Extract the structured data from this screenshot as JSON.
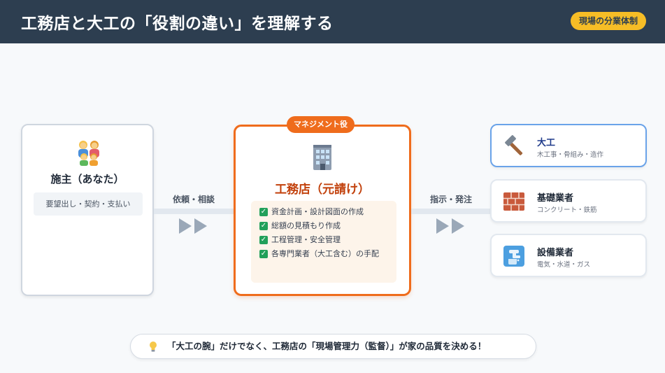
{
  "header": {
    "title": "工務店と大工の「役割の違い」を理解する",
    "badge": "現場の分業体制"
  },
  "owner": {
    "icon": "family-icon",
    "title": "施主（あなた）",
    "tags": "要望出し・契約・支払い"
  },
  "connectors": {
    "left_label": "依頼・相談",
    "right_label": "指示・発注"
  },
  "company": {
    "badge": "マネジメント役",
    "icon": "building-icon",
    "title": "工務店（元請け）",
    "duties": [
      "資金計画・設計図面の作成",
      "総額の見積もり作成",
      "工程管理・安全管理",
      "各専門業者（大工含む）の手配"
    ]
  },
  "trades": [
    {
      "icon": "hammer-icon",
      "name": "大工",
      "sub": "木工事・骨組み・造作"
    },
    {
      "icon": "brick-icon",
      "name": "基礎業者",
      "sub": "コンクリート・鉄筋"
    },
    {
      "icon": "faucet-icon",
      "name": "設備業者",
      "sub": "電気・水道・ガス"
    }
  ],
  "footer": {
    "icon": "lightbulb-icon",
    "text": "「大工の腕」だけでなく、工務店の「現場管理力（監督）」が家の品質を決める！"
  },
  "colors": {
    "header_bg": "#2d3e50",
    "badge_bg": "#f6bd26",
    "accent_orange": "#ef6c1c",
    "accent_blue": "#6aa3e9",
    "check_green": "#22a05a"
  }
}
